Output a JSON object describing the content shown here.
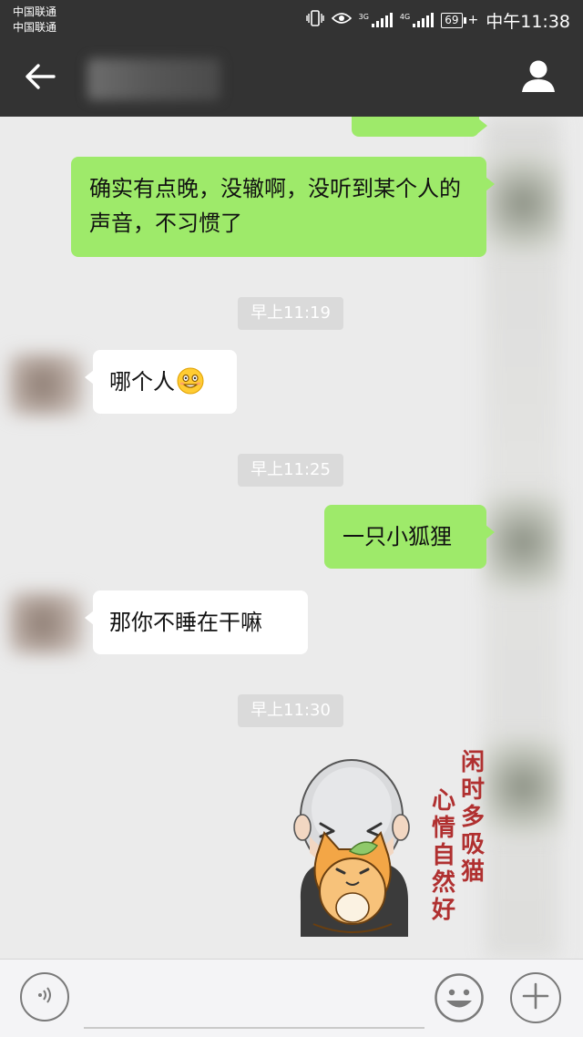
{
  "status_bar": {
    "carrier_1": "中国联通",
    "carrier_2": "中国联通",
    "network_1": "3G",
    "network_2": "4G",
    "battery": "69",
    "time": "中午11:38"
  },
  "header": {
    "back_icon": "arrow-left-icon",
    "profile_icon": "person-icon"
  },
  "messages": [
    {
      "id": "m1",
      "direction": "out",
      "text": "确实有点晚，没辙啊，没听到某个人的声音，不习惯了"
    },
    {
      "id": "t1",
      "type": "timestamp",
      "text": "早上11:19"
    },
    {
      "id": "m2",
      "direction": "in",
      "text": "哪个人",
      "emoji": "grinning-sweat-face"
    },
    {
      "id": "t2",
      "type": "timestamp",
      "text": "早上11:25"
    },
    {
      "id": "m3",
      "direction": "out",
      "text": "一只小狐狸"
    },
    {
      "id": "m4",
      "direction": "in",
      "text": "那你不睡在干嘛"
    },
    {
      "id": "t3",
      "type": "timestamp",
      "text": "早上11:30"
    },
    {
      "id": "m5",
      "direction": "out",
      "type": "sticker",
      "sticker_text_1": "闲时多吸猫",
      "sticker_text_2": "心情自然好"
    }
  ],
  "input_bar": {
    "voice_icon": "voice-icon",
    "input_value": "",
    "emoji_icon": "smiley-icon",
    "plus_icon": "plus-icon"
  },
  "colors": {
    "header_bg": "#333333",
    "chat_bg": "#ebebeb",
    "outgoing_bubble": "#9eea6a",
    "incoming_bubble": "#ffffff",
    "timestamp_bg": "#dadada"
  }
}
